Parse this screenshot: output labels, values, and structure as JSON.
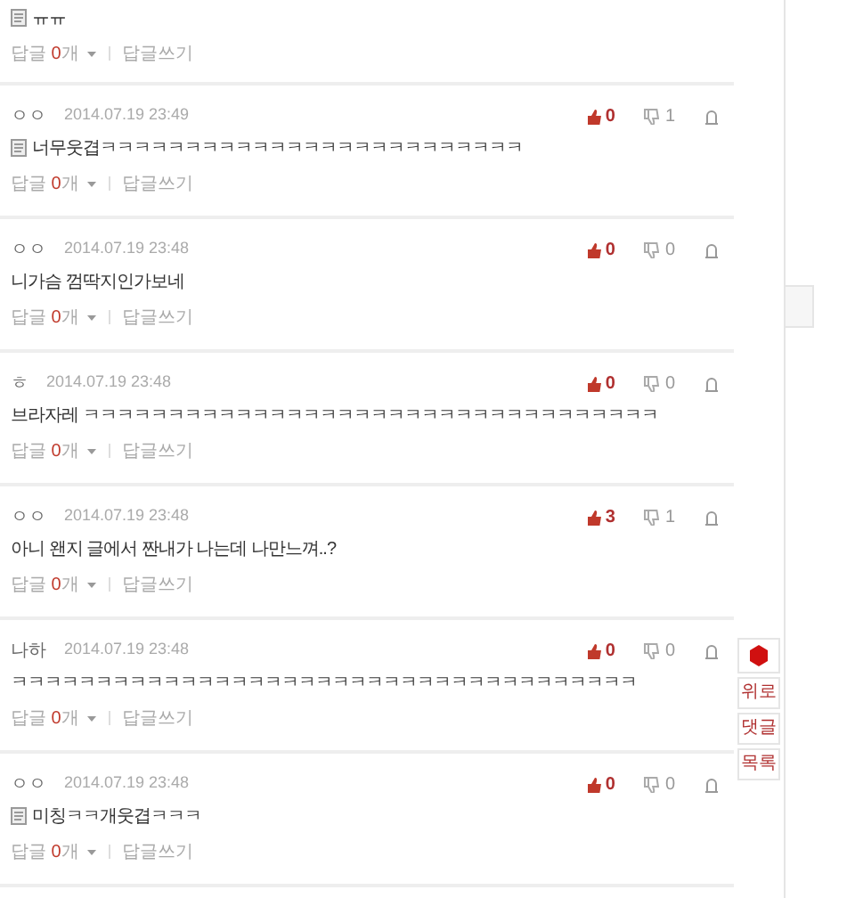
{
  "top_comment": {
    "text": "ㅠㅠ",
    "memo_icon": true,
    "reply_label": "답글",
    "reply_count": "0",
    "reply_unit": "개",
    "write_reply": "답글쓰기"
  },
  "comments": [
    {
      "author": "ㅇㅇ",
      "date": "2014.07.19 23:49",
      "memo_icon": true,
      "text": "너무웃겹ㅋㅋㅋㅋㅋㅋㅋㅋㅋㅋㅋㅋㅋㅋㅋㅋㅋㅋㅋㅋㅋㅋㅋㅋㅋ",
      "likes": "0",
      "dislikes": "1",
      "reply_label": "답글",
      "reply_count": "0",
      "reply_unit": "개",
      "write_reply": "답글쓰기"
    },
    {
      "author": "ㅇㅇ",
      "date": "2014.07.19 23:48",
      "memo_icon": false,
      "text": "니가슴 껌딱지인가보네",
      "likes": "0",
      "dislikes": "0",
      "reply_label": "답글",
      "reply_count": "0",
      "reply_unit": "개",
      "write_reply": "답글쓰기"
    },
    {
      "author": "ㅎ",
      "date": "2014.07.19 23:48",
      "memo_icon": false,
      "text": "브라자레 ㅋㅋㅋㅋㅋㅋㅋㅋㅋㅋㅋㅋㅋㅋㅋㅋㅋㅋㅋㅋㅋㅋㅋㅋㅋㅋㅋㅋㅋㅋㅋㅋㅋㅋ",
      "likes": "0",
      "dislikes": "0",
      "reply_label": "답글",
      "reply_count": "0",
      "reply_unit": "개",
      "write_reply": "답글쓰기"
    },
    {
      "author": "ㅇㅇ",
      "date": "2014.07.19 23:48",
      "memo_icon": false,
      "text": "아니 왠지 글에서 짠내가 나는데 나만느껴..?",
      "likes": "3",
      "dislikes": "1",
      "reply_label": "답글",
      "reply_count": "0",
      "reply_unit": "개",
      "write_reply": "답글쓰기"
    },
    {
      "author": "나하",
      "date": "2014.07.19 23:48",
      "memo_icon": false,
      "text": "ㅋㅋㅋㅋㅋㅋㅋㅋㅋㅋㅋㅋㅋㅋㅋㅋㅋㅋㅋㅋㅋㅋㅋㅋㅋㅋㅋㅋㅋㅋㅋㅋㅋㅋㅋㅋㅋ",
      "likes": "0",
      "dislikes": "0",
      "reply_label": "답글",
      "reply_count": "0",
      "reply_unit": "개",
      "write_reply": "답글쓰기"
    },
    {
      "author": "ㅇㅇ",
      "date": "2014.07.19 23:48",
      "memo_icon": true,
      "text": "미칭ㅋㅋ개웃겹ㅋㅋㅋ",
      "likes": "0",
      "dislikes": "0",
      "reply_label": "답글",
      "reply_count": "0",
      "reply_unit": "개",
      "write_reply": "답글쓰기"
    }
  ],
  "side_buttons": [
    "위로",
    "댓글",
    "목록"
  ]
}
